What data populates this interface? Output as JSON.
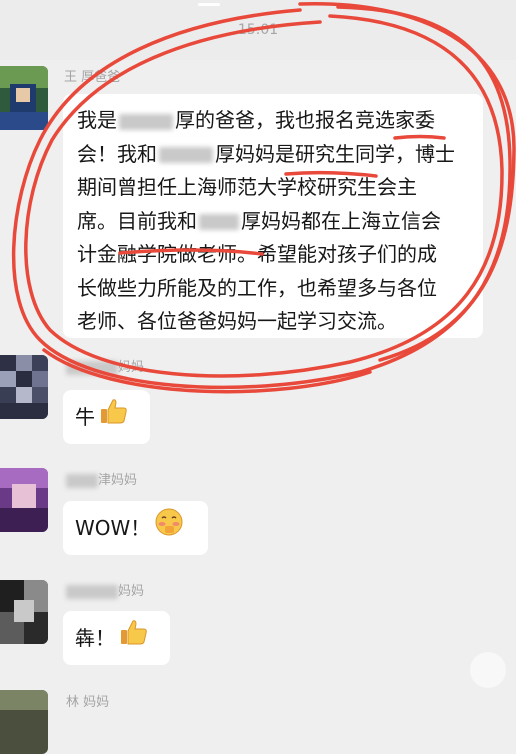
{
  "status_time": "15:01",
  "messages": [
    {
      "sender": "王 厚爸爸",
      "text_lines": [
        [
          "我是",
          "",
          "厚的爸爸，我也报名竞选家委"
        ],
        [
          "会！我和",
          "",
          "厚妈妈是研究生同学，博士"
        ],
        [
          "期间曾担任上海师范大学校研究生会主"
        ],
        [
          "席。目前我和",
          "",
          "厚妈妈都在上海立信会"
        ],
        [
          "计金融学院做老师。希望能对孩子们的成"
        ],
        [
          "长做些力所能及的工作，也希望多与各位"
        ],
        [
          "老师、各位爸爸妈妈一起学习交流。"
        ]
      ]
    },
    {
      "sender": "妈妈",
      "text": "牛",
      "emoji": "thumbs-up"
    },
    {
      "sender": "津妈妈",
      "text": "WOW！",
      "emoji": "blushing-face"
    },
    {
      "sender": "妈妈",
      "text": "犇！",
      "emoji": "thumbs-up"
    },
    {
      "sender": "林 妈妈"
    }
  ],
  "colors": {
    "highlight_red": "#e8493a",
    "bubble": "#ffffff",
    "background": "#efefef"
  }
}
